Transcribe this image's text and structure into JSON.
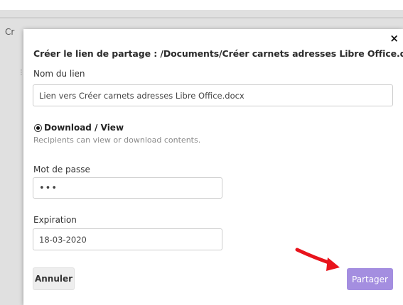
{
  "background": {
    "partial_text": "Cr",
    "dot": "⁝"
  },
  "dialog": {
    "title": "Créer le lien de partage : /Documents/Créer carnets adresses Libre Office.docx",
    "close_label": "×",
    "link_name": {
      "label": "Nom du lien",
      "value": "Lien vers Créer carnets adresses Libre Office.docx"
    },
    "permission": {
      "label": "Download / View",
      "help": "Recipients can view or download contents.",
      "selected": true
    },
    "password": {
      "label": "Mot de passe",
      "value": "•••"
    },
    "expiration": {
      "label": "Expiration",
      "value": "18-03-2020"
    },
    "cancel_label": "Annuler",
    "share_label": "Partager"
  },
  "colors": {
    "share_button": "#a48ee0",
    "annotation_arrow": "#e8141c",
    "backdrop": "#e0e0e0"
  },
  "icons": {
    "close": "close-icon",
    "radio": "radio-selected-icon",
    "annotation": "red-arrow-icon"
  }
}
